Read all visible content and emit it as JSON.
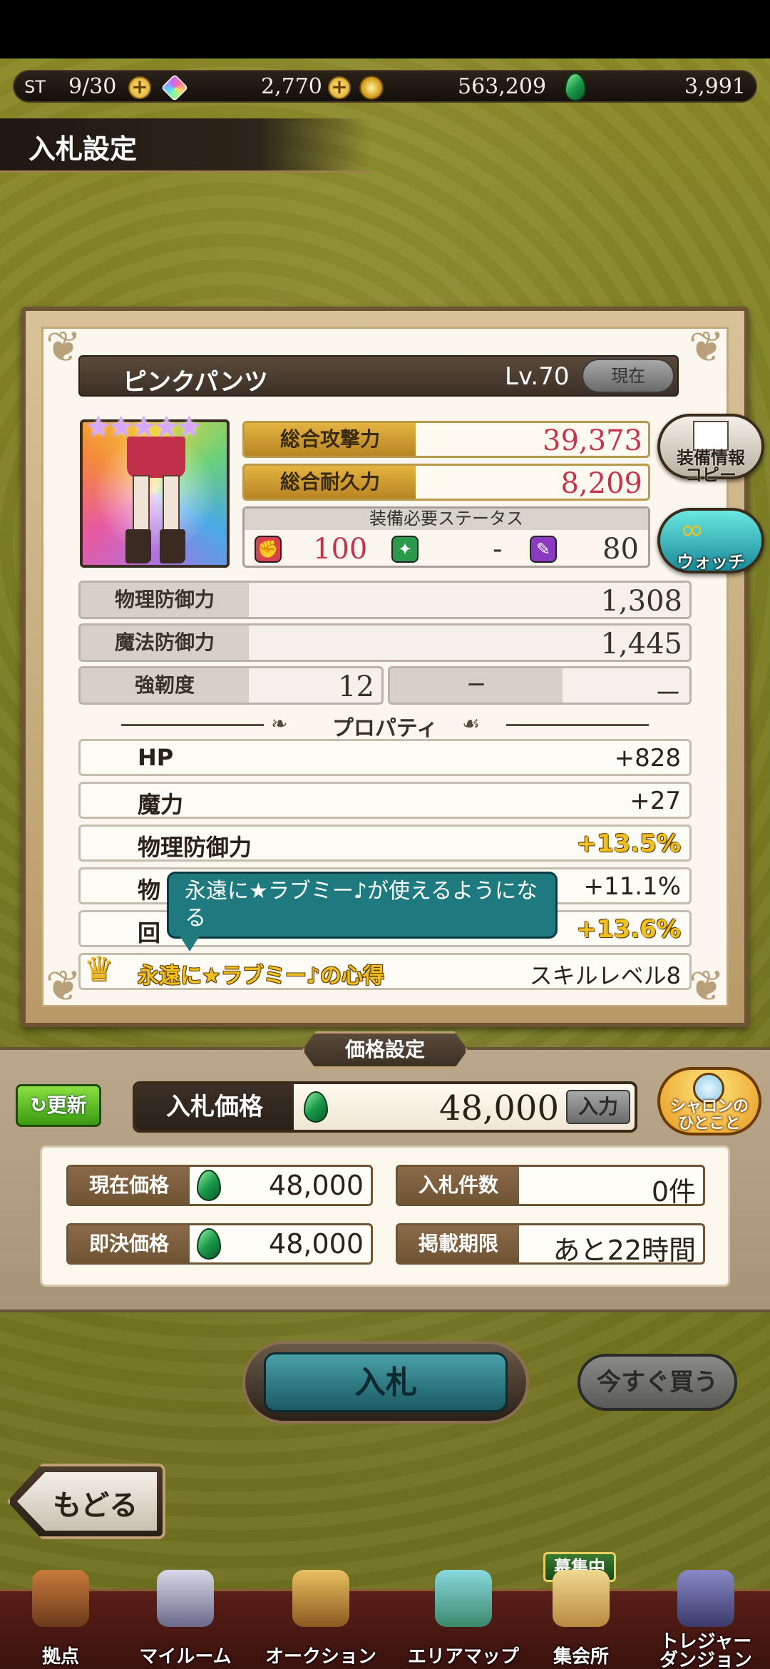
{
  "status_bar": {
    "stamina_label": "ST",
    "stamina": "9/30",
    "rainbow_gems": "2,770",
    "gold": "563,209",
    "green_gems": "3,991"
  },
  "header": {
    "title": "入札設定"
  },
  "item": {
    "name": "ピンクパンツ",
    "level": "Lv.70",
    "current_badge": "現在",
    "stars": "★★★★★",
    "total_attack_label": "総合攻撃力",
    "total_attack": "39,373",
    "total_durability_label": "総合耐久力",
    "total_durability": "8,209",
    "required_status_label": "装備必要ステータス",
    "required": {
      "power": "100",
      "skill": "-",
      "magic": "80"
    },
    "phys_def_label": "物理防御力",
    "phys_def": "1,308",
    "magic_def_label": "魔法防御力",
    "magic_def": "1,445",
    "toughness_label": "強靭度",
    "toughness": "12",
    "extra_label": "－",
    "extra_value": "－"
  },
  "side_buttons": {
    "copy_label": "装備情報\nコピー",
    "watch_label": "ウォッチ"
  },
  "properties": {
    "title": "プロパティ",
    "rows": [
      {
        "name": "HP",
        "value": "+828"
      },
      {
        "name": "魔力",
        "value": "+27"
      },
      {
        "name": "物理防御力",
        "value": "+13.5%"
      },
      {
        "name": "物",
        "value": "+11.1%"
      },
      {
        "name": "回",
        "value": "+13.6%"
      }
    ],
    "skill_name": "永遠に★ラブミー♪の心得",
    "skill_level": "スキルレベル8",
    "tooltip": "永遠に★ラブミー♪が使えるようになる"
  },
  "price": {
    "section_title": "価格設定",
    "refresh_label": "更新",
    "bid_price_label": "入札価格",
    "bid_price_value": "48,000",
    "input_label": "入力",
    "sharon_label": "シャロンの\nひとこと",
    "current_price_label": "現在価格",
    "current_price": "48,000",
    "buyout_price_label": "即決価格",
    "buyout_price": "48,000",
    "bid_count_label": "入札件数",
    "bid_count": "0件",
    "deadline_label": "掲載期限",
    "deadline": "あと22時間"
  },
  "actions": {
    "bid": "入札",
    "buy_now": "今すぐ買う",
    "back": "もどる"
  },
  "nav": {
    "recruit_badge": "募集中",
    "items": [
      {
        "label": "拠点"
      },
      {
        "label": "マイルーム"
      },
      {
        "label": "オークション"
      },
      {
        "label": "エリアマップ"
      },
      {
        "label": "集会所"
      },
      {
        "label": "トレジャー\nダンジョン"
      }
    ]
  }
}
